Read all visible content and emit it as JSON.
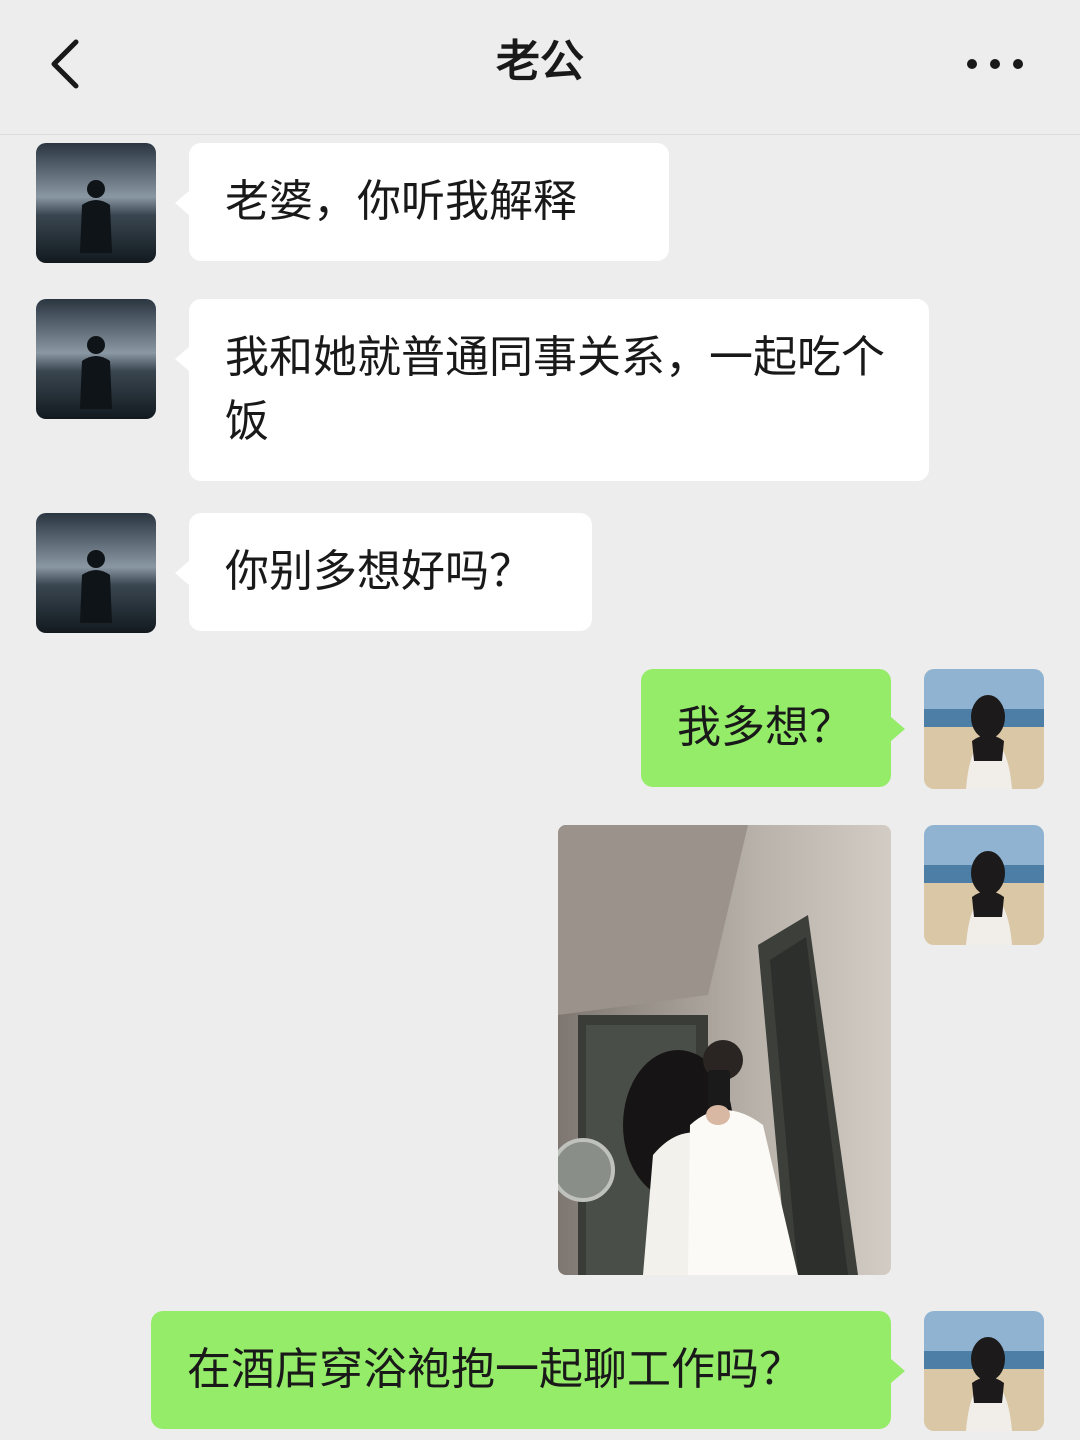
{
  "header": {
    "title": "老公"
  },
  "icons": {
    "back": "chevron-left-icon",
    "more": "more-dots-icon"
  },
  "messages": [
    {
      "side": "left",
      "type": "text",
      "text": "老婆，你听我解释"
    },
    {
      "side": "left",
      "type": "text",
      "text": "我和她就普通同事关系，一起吃个饭"
    },
    {
      "side": "left",
      "type": "text",
      "text": "你别多想好吗？"
    },
    {
      "side": "right",
      "type": "text",
      "text": "我多想？"
    },
    {
      "side": "right",
      "type": "image",
      "description_icon": "photo-icon"
    },
    {
      "side": "right",
      "type": "text",
      "text": "在酒店穿浴袍抱一起聊工作吗？"
    }
  ],
  "colors": {
    "background": "#ededed",
    "incoming_bubble": "#ffffff",
    "outgoing_bubble": "#95ec69",
    "text": "#191919"
  }
}
